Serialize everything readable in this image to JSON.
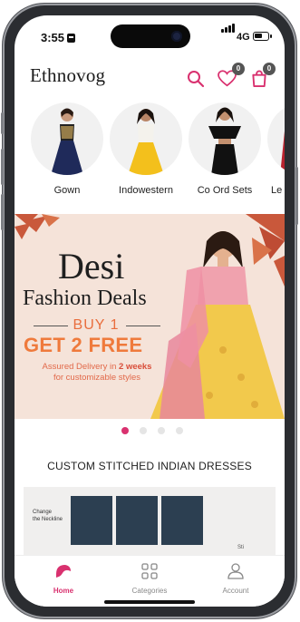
{
  "status_bar": {
    "time": "3:55",
    "network": "4G"
  },
  "header": {
    "logo": "Ethnovog",
    "wishlist_count": "0",
    "cart_count": "0"
  },
  "categories": [
    {
      "label": "Gown"
    },
    {
      "label": "Indowestern"
    },
    {
      "label": "Co Ord Sets"
    },
    {
      "label": "Le"
    }
  ],
  "banner": {
    "title_line1": "Desi",
    "title_line2": "Fashion Deals",
    "offer_line1": "BUY 1",
    "offer_line2": "GET 2 FREE",
    "delivery_prefix": "Assured Delivery in ",
    "delivery_highlight": "2 weeks",
    "delivery_suffix": "for customizable styles"
  },
  "carousel": {
    "total": 4,
    "active": 0
  },
  "section": {
    "title": "CUSTOM STITCHED INDIAN DRESSES"
  },
  "custom_panel": {
    "note_line1": "Change",
    "note_line2": "the Neckline",
    "peek_text": "Sti"
  },
  "bottom_nav": [
    {
      "label": "Home",
      "active": true
    },
    {
      "label": "Categories",
      "active": false
    },
    {
      "label": "Account",
      "active": false
    }
  ],
  "colors": {
    "accent": "#d9316f",
    "offer_orange": "#ef7a3c",
    "banner_bg": "#f5e3d9"
  }
}
